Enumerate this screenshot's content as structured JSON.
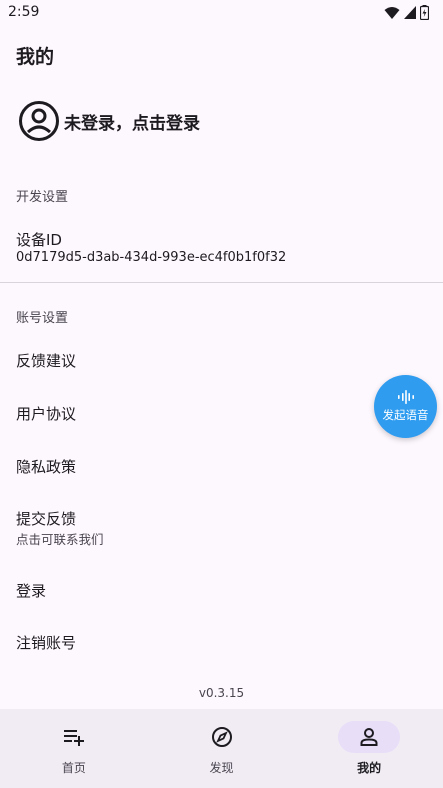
{
  "status_bar": {
    "time": "2:59",
    "icons": [
      "wifi-icon",
      "signal-icon",
      "battery-icon"
    ]
  },
  "page_title": "我的",
  "login": {
    "avatar_icon": "account-circle-icon",
    "text": "未登录，点击登录"
  },
  "dev_settings": {
    "header": "开发设置",
    "device_id_label": "设备ID",
    "device_id_value": "0d7179d5-d3ab-434d-993e-ec4f0b1f0f32"
  },
  "account_settings": {
    "header": "账号设置",
    "items": [
      {
        "label": "反馈建议"
      },
      {
        "label": "用户协议"
      },
      {
        "label": "隐私政策"
      },
      {
        "label": "提交反馈",
        "sub": "点击可联系我们"
      },
      {
        "label": "登录"
      },
      {
        "label": "注销账号"
      }
    ]
  },
  "version": "v0.3.15",
  "fab": {
    "icon": "voice-wave-icon",
    "label": "发起语音",
    "color": "#2f9cf0"
  },
  "bottom_nav": {
    "items": [
      {
        "label": "首页",
        "icon": "playlist-add-icon",
        "active": false
      },
      {
        "label": "发现",
        "icon": "compass-icon",
        "active": false
      },
      {
        "label": "我的",
        "icon": "person-icon",
        "active": true
      }
    ]
  },
  "colors": {
    "background": "#fdf7fe",
    "nav_background": "#f1ecf4",
    "active_pill": "#e8def8"
  }
}
